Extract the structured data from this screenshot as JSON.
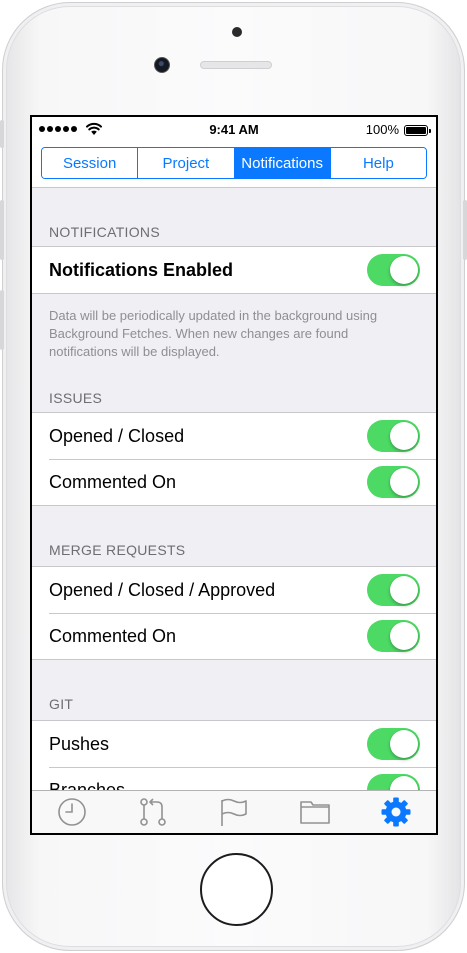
{
  "status_bar": {
    "time": "9:41 AM",
    "battery": "100%"
  },
  "segments": [
    {
      "label": "Session",
      "active": false
    },
    {
      "label": "Project",
      "active": false
    },
    {
      "label": "Notifications",
      "active": true
    },
    {
      "label": "Help",
      "active": false
    }
  ],
  "sections": {
    "notifications": {
      "header": "NOTIFICATIONS",
      "rows": [
        {
          "label": "Notifications Enabled",
          "on": true
        }
      ],
      "footer": "Data will be periodically updated in the background using Background Fetches. When new changes are found notifications will be displayed."
    },
    "issues": {
      "header": "ISSUES",
      "rows": [
        {
          "label": "Opened / Closed",
          "on": true
        },
        {
          "label": "Commented On",
          "on": true
        }
      ]
    },
    "merge_requests": {
      "header": "MERGE REQUESTS",
      "rows": [
        {
          "label": "Opened / Closed / Approved",
          "on": true
        },
        {
          "label": "Commented On",
          "on": true
        }
      ]
    },
    "git": {
      "header": "GIT",
      "rows": [
        {
          "label": "Pushes",
          "on": true
        },
        {
          "label": "Branches",
          "on": true
        }
      ]
    }
  },
  "tabbar": {
    "items": [
      {
        "icon": "clock-icon",
        "selected": false
      },
      {
        "icon": "merge-request-icon",
        "selected": false
      },
      {
        "icon": "flag-icon",
        "selected": false
      },
      {
        "icon": "folder-icon",
        "selected": false
      },
      {
        "icon": "gear-icon",
        "selected": true
      }
    ]
  },
  "colors": {
    "accent": "#0a79ff",
    "toggle_on": "#4cd964",
    "tab_inactive": "#929292"
  }
}
